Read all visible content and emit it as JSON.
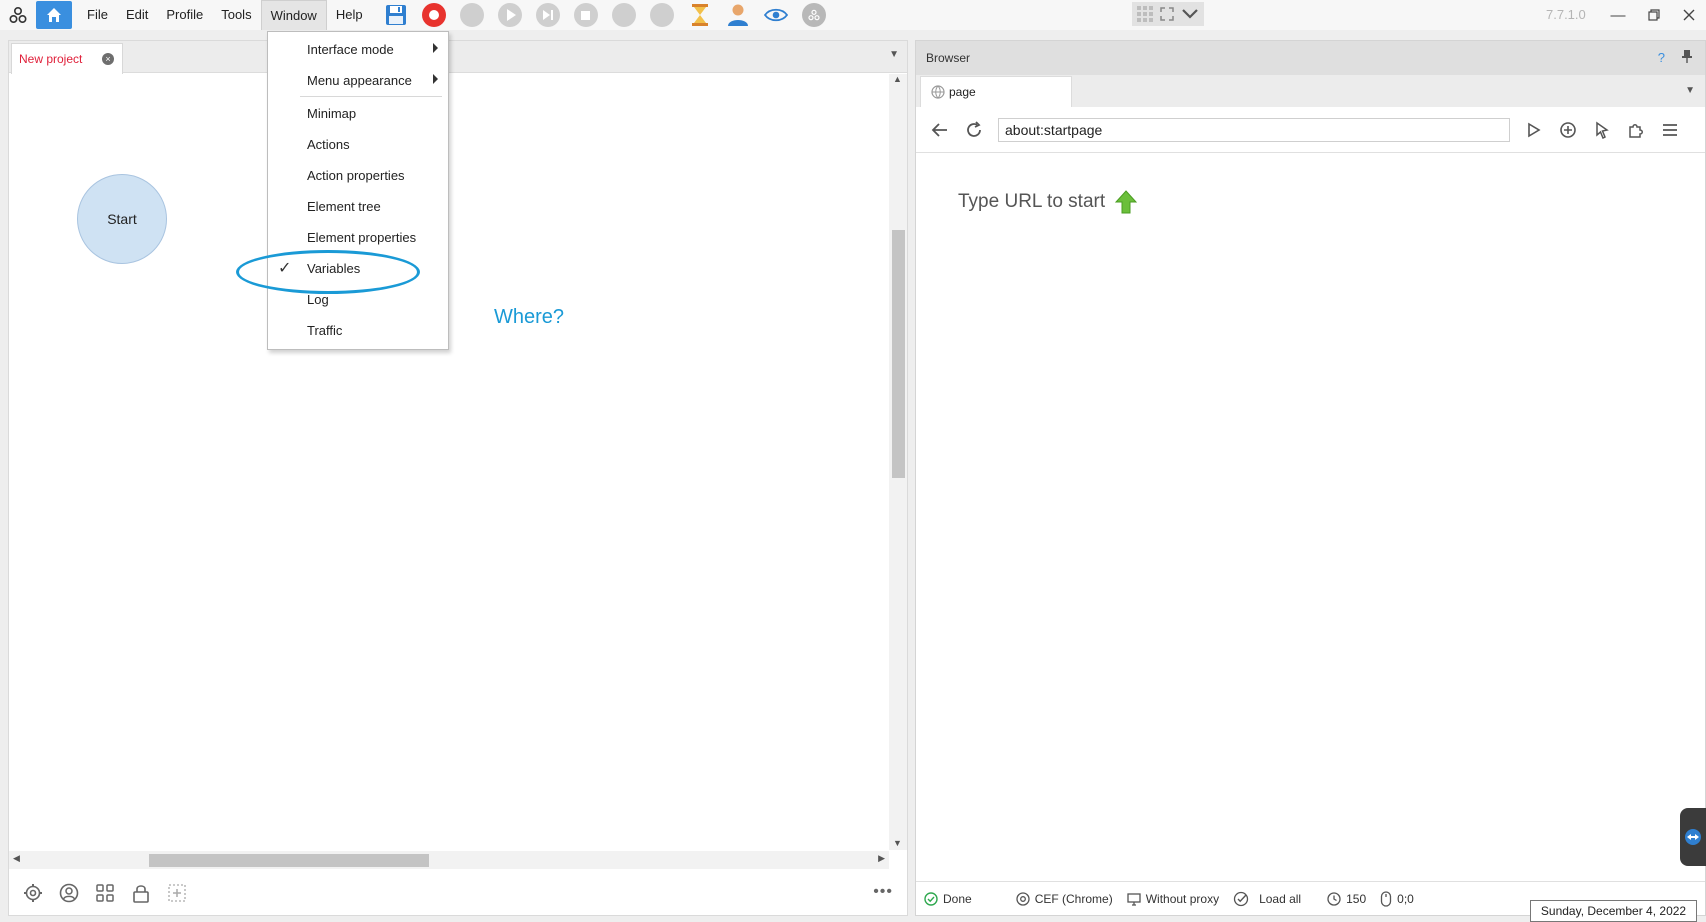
{
  "menubar": {
    "items": [
      "File",
      "Edit",
      "Profile",
      "Tools",
      "Window",
      "Help"
    ],
    "active": "Window"
  },
  "version": "7.7.1.0",
  "project_tab": {
    "label": "New project"
  },
  "canvas": {
    "start_node": "Start",
    "annotation": "Where?"
  },
  "window_menu": {
    "items": [
      {
        "label": "Interface mode",
        "submenu": true
      },
      {
        "label": "Menu appearance",
        "submenu": true
      },
      {
        "label": "Minimap"
      },
      {
        "label": "Actions"
      },
      {
        "label": "Action properties"
      },
      {
        "label": "Element tree"
      },
      {
        "label": "Element properties"
      },
      {
        "label": "Variables",
        "checked": true
      },
      {
        "label": "Log"
      },
      {
        "label": "Traffic"
      }
    ],
    "check_glyph": "✓"
  },
  "browser": {
    "title": "Browser",
    "help": "?",
    "tab_label": "page",
    "url": "about:startpage",
    "start_hint": "Type URL to start",
    "status": {
      "state": "Done",
      "engine": "CEF (Chrome)",
      "proxy": "Without proxy",
      "load": "Load all",
      "timeout": "150",
      "coords": "0;0"
    }
  },
  "tooltip_date": "Sunday, December 4, 2022",
  "colors": {
    "accent_blue": "#1a9ad6",
    "home_blue": "#3a8fdf",
    "tab_red": "#e0203a",
    "node_fill": "#cfe2f3"
  }
}
